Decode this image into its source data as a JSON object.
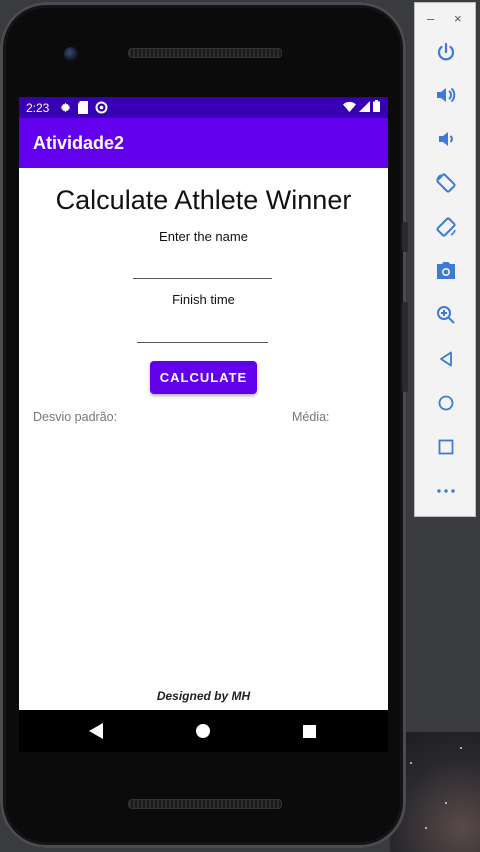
{
  "status_bar": {
    "time": "2:23"
  },
  "app_bar": {
    "title": "Atividade2"
  },
  "main": {
    "title": "Calculate Athlete Winner",
    "name_label": "Enter the name",
    "name_value": "",
    "time_label": "Finish time",
    "time_value": "",
    "calculate_label": "CALCULATE",
    "std_dev_label": "Desvio padrão:",
    "mean_label": "Média:",
    "footer": "Designed by MH"
  },
  "panel": {
    "minimize": "–",
    "close": "×"
  },
  "colors": {
    "primary": "#6200ee",
    "primary_dark": "#3700b3"
  }
}
